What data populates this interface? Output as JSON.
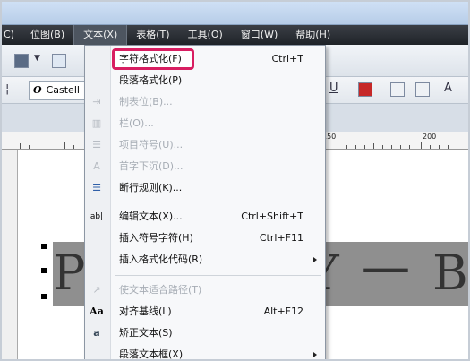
{
  "menubar": {
    "items": [
      {
        "label": "C)"
      },
      {
        "label": "位图(B)"
      },
      {
        "label": "文本(X)"
      },
      {
        "label": "表格(T)"
      },
      {
        "label": "工具(O)"
      },
      {
        "label": "窗口(W)"
      },
      {
        "label": "帮助(H)"
      }
    ]
  },
  "toolbar": {
    "font_name": "Castell",
    "font_icon": "O"
  },
  "ruler": {
    "labels": [
      "150",
      "200"
    ]
  },
  "document": {
    "text_left": "P",
    "text_right": "Y 一 B"
  },
  "menu": {
    "items": [
      {
        "label": "字符格式化(F)",
        "shortcut": "Ctrl+T",
        "icon": "none",
        "enabled": true
      },
      {
        "label": "段落格式化(P)",
        "shortcut": "",
        "icon": "none",
        "enabled": true
      },
      {
        "label": "制表位(B)...",
        "shortcut": "",
        "icon": "tab-stop-icon",
        "enabled": false
      },
      {
        "label": "栏(O)...",
        "shortcut": "",
        "icon": "columns-icon",
        "enabled": false
      },
      {
        "label": "项目符号(U)...",
        "shortcut": "",
        "icon": "bullets-icon",
        "enabled": false
      },
      {
        "label": "首字下沉(D)...",
        "shortcut": "",
        "icon": "drop-cap-icon",
        "enabled": false
      },
      {
        "label": "断行规则(K)...",
        "shortcut": "",
        "icon": "line-break-icon",
        "enabled": true
      },
      {
        "label": "编辑文本(X)...",
        "shortcut": "Ctrl+Shift+T",
        "icon": "edit-text-icon",
        "enabled": true
      },
      {
        "label": "插入符号字符(H)",
        "shortcut": "Ctrl+F11",
        "icon": "none",
        "enabled": true
      },
      {
        "label": "插入格式化代码(R)",
        "shortcut": "",
        "icon": "none",
        "enabled": true,
        "submenu": true
      },
      {
        "label": "使文本适合路径(T)",
        "shortcut": "",
        "icon": "fit-path-icon",
        "enabled": false
      },
      {
        "label": "对齐基线(L)",
        "shortcut": "Alt+F12",
        "icon": "align-baseline-icon",
        "enabled": true
      },
      {
        "label": "矫正文本(S)",
        "shortcut": "",
        "icon": "straighten-text-icon",
        "enabled": true
      },
      {
        "label": "段落文本框(X)",
        "shortcut": "",
        "icon": "none",
        "enabled": true,
        "submenu": true
      }
    ]
  }
}
